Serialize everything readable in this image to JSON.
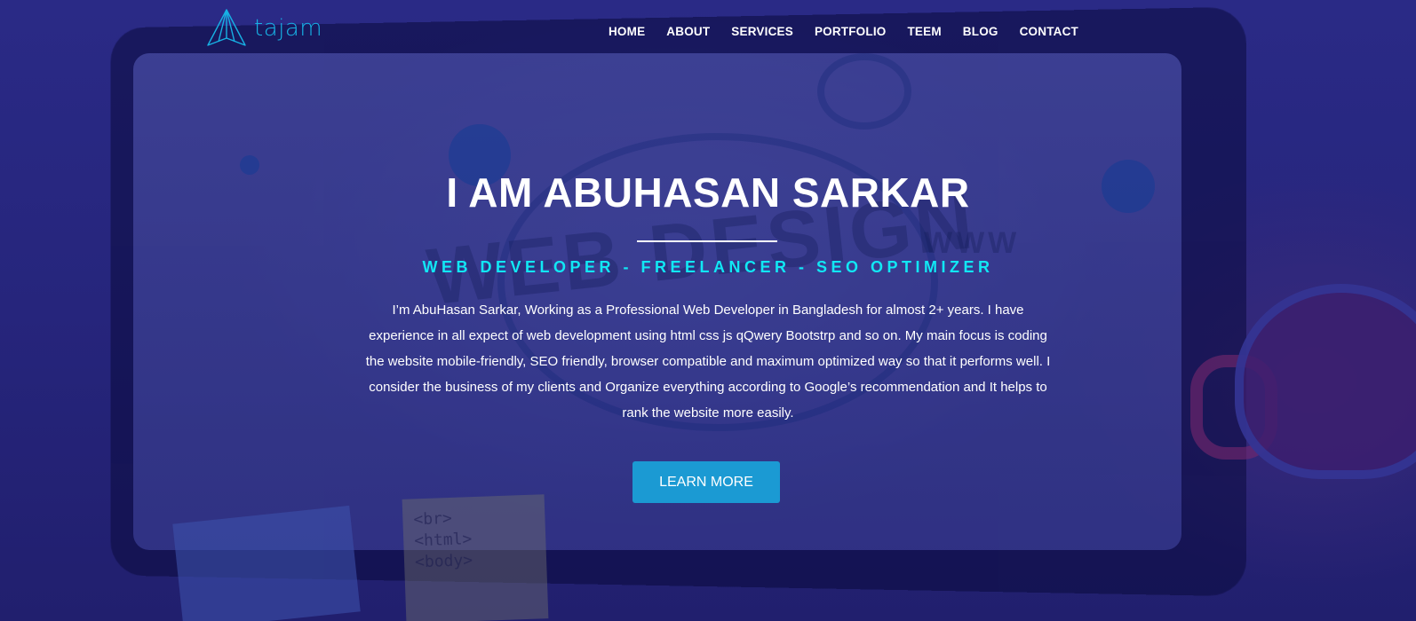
{
  "brand": {
    "name": "tajam",
    "logo_icon": "paper-plane-icon",
    "accent_color": "#17b1e4"
  },
  "nav": {
    "items": [
      {
        "label": "HOME"
      },
      {
        "label": "ABOUT"
      },
      {
        "label": "SERVICES"
      },
      {
        "label": "PORTFOLIO"
      },
      {
        "label": "TEEM"
      },
      {
        "label": "BLOG"
      },
      {
        "label": "CONTACT"
      }
    ]
  },
  "hero": {
    "title": "I AM ABUHASAN SARKAR",
    "subtitle": "WEB DEVELOPER - FREELANCER - SEO OPTIMIZER",
    "subtitle_color": "#11e7f4",
    "description": "I’m AbuHasan Sarkar, Working as a Professional Web Developer in Bangladesh for almost 2+ years. I have experience in all expect of web development using html css js qQwery Bootstrp and so on. My main focus is coding the website mobile-friendly, SEO friendly, browser compatible and maximum optimized way so that it performs well. I consider the business of my clients and Organize everything according to Google’s recommendation and It helps to rank the website more easily.",
    "cta_label": "LEARN MORE",
    "cta_color": "#1b9ad3"
  },
  "background": {
    "overlay_color": "#26257c",
    "sticky_note_lines": [
      "<br>",
      "<html>",
      "<body>"
    ],
    "decor_words": [
      "WEB DESIGN",
      "WWW"
    ]
  }
}
